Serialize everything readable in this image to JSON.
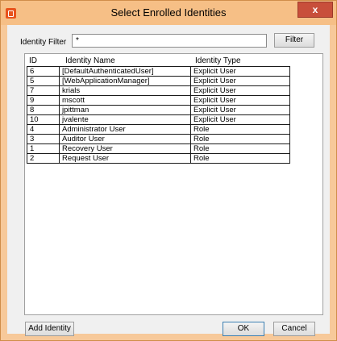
{
  "window": {
    "title": "Select Enrolled Identities",
    "close_glyph": "x",
    "icon": "app-logo-icon"
  },
  "filter": {
    "label": "Identity Filter",
    "value": "*",
    "button": "Filter"
  },
  "table": {
    "headers": {
      "id": "ID",
      "name": "Identity Name",
      "type": "Identity Type"
    },
    "rows": [
      {
        "id": "6",
        "name": "[DefaultAuthenticatedUser]",
        "type": "Explicit User"
      },
      {
        "id": "5",
        "name": "[WebApplicationManager]",
        "type": "Explicit User"
      },
      {
        "id": "7",
        "name": "krials",
        "type": "Explicit User"
      },
      {
        "id": "9",
        "name": "mscott",
        "type": "Explicit User"
      },
      {
        "id": "8",
        "name": "jpittman",
        "type": "Explicit User"
      },
      {
        "id": "10",
        "name": "jvalente",
        "type": "Explicit User"
      },
      {
        "id": "4",
        "name": "Administrator User",
        "type": "Role"
      },
      {
        "id": "3",
        "name": "Auditor User",
        "type": "Role"
      },
      {
        "id": "1",
        "name": "Recovery User",
        "type": "Role"
      },
      {
        "id": "2",
        "name": "Request User",
        "type": "Role"
      }
    ]
  },
  "footer": {
    "add_identity": "Add Identity",
    "ok": "OK",
    "cancel": "Cancel"
  },
  "colors": {
    "titlebar": "#f6bf86",
    "close": "#c84f3b",
    "dialog_bg": "#f0f0f0"
  }
}
